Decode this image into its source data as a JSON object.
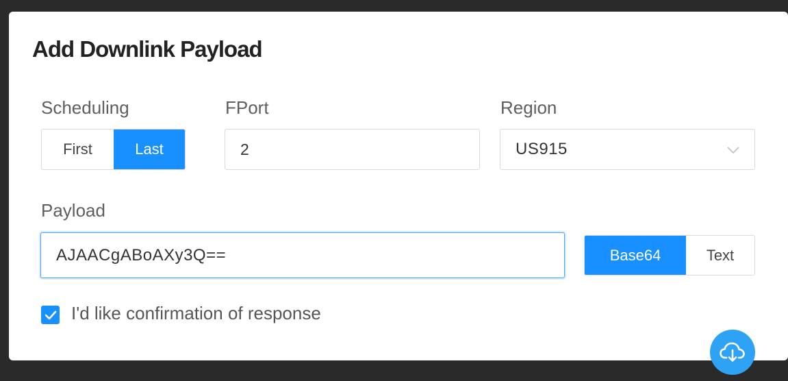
{
  "dialog": {
    "title": "Add Downlink Payload"
  },
  "scheduling": {
    "label": "Scheduling",
    "options": [
      {
        "label": "First",
        "selected": false
      },
      {
        "label": "Last",
        "selected": true
      }
    ]
  },
  "fport": {
    "label": "FPort",
    "value": "2"
  },
  "region": {
    "label": "Region",
    "selected": "US915"
  },
  "payload": {
    "label": "Payload",
    "value": "AJAACgABoAXy3Q==",
    "encoding_options": [
      {
        "label": "Base64",
        "selected": true
      },
      {
        "label": "Text",
        "selected": false
      }
    ]
  },
  "confirmation": {
    "label": "I'd like confirmation of response",
    "checked": true
  },
  "fab": {
    "icon": "cloud-download-icon"
  },
  "colors": {
    "accent": "#1890ff",
    "fab": "#2ea2f5",
    "background_dark": "#2a2a2a"
  }
}
